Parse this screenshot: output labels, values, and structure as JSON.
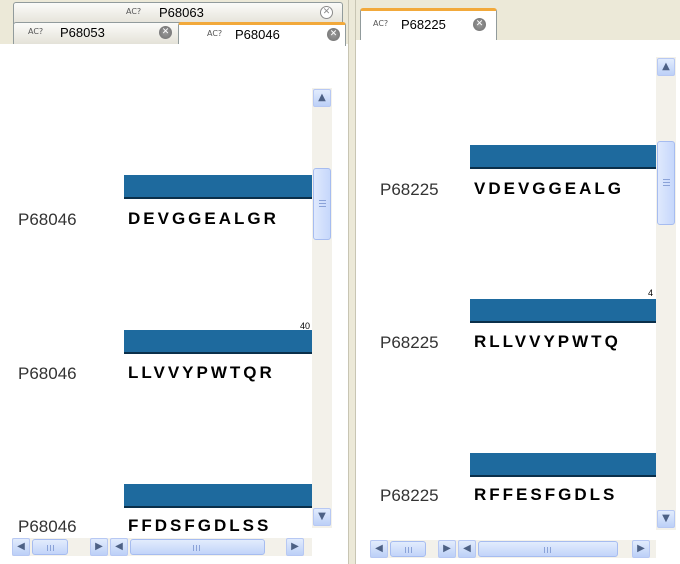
{
  "left": {
    "tab_row_back": {
      "tab": {
        "label": "P68063"
      }
    },
    "tab_row_front": {
      "tabs": [
        {
          "label": "P68053"
        },
        {
          "label": "P68046"
        }
      ]
    },
    "sequences": [
      {
        "name": "P68046",
        "residues": "DEVGGEALGR"
      },
      {
        "name": "P68046",
        "residues": "LLVVYPWTQR",
        "ruler": "40"
      },
      {
        "name": "P68046",
        "residues": "FFDSFGDLSS"
      }
    ]
  },
  "right": {
    "tab": {
      "label": "P68225"
    },
    "sequences": [
      {
        "name": "P68225",
        "residues": "VDEVGGEALG"
      },
      {
        "name": "P68225",
        "residues": "RLLVVYPWTQ",
        "ruler": "4"
      },
      {
        "name": "P68225",
        "residues": "RFFESFGDLS"
      }
    ]
  },
  "icons": {
    "tab_icon": "AC?",
    "close_icon": "✕",
    "scroll_up": "▲",
    "scroll_down": "▼",
    "scroll_left": "◀",
    "scroll_right": "▶"
  },
  "colors": {
    "sequence_bar": "#1e6a9e",
    "active_tab_accent": "#f2a93b"
  }
}
